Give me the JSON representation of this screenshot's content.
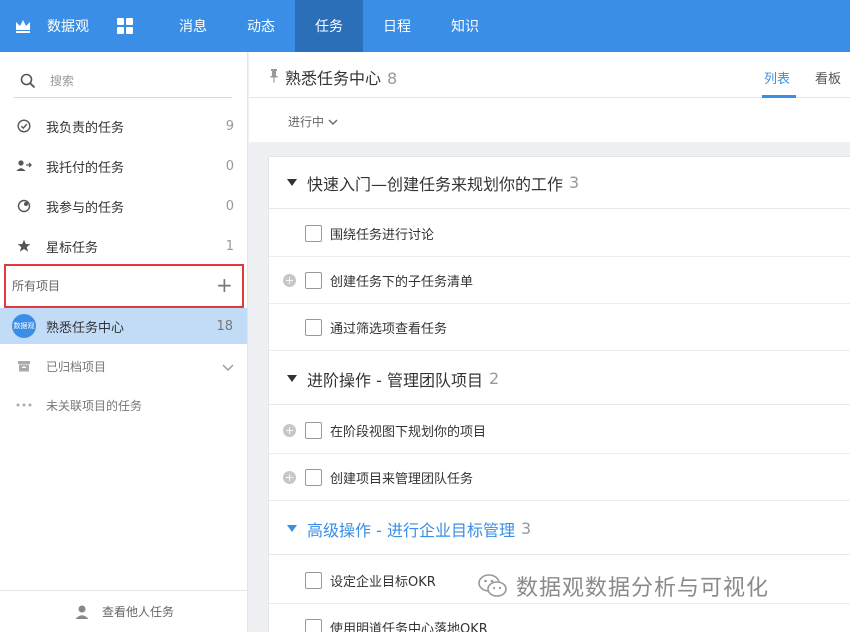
{
  "topnav": {
    "brand": "数据观",
    "items": [
      "消息",
      "动态",
      "任务",
      "日程",
      "知识"
    ],
    "active_index": 2,
    "bg": "#3a8ee6",
    "active_bg": "#2a6fb8"
  },
  "sidebar": {
    "search_placeholder": "搜索",
    "items": [
      {
        "icon": "check-circle-icon",
        "label": "我负责的任务",
        "count": "9"
      },
      {
        "icon": "user-forward-icon",
        "label": "我托付的任务",
        "count": "0"
      },
      {
        "icon": "participate-icon",
        "label": "我参与的任务",
        "count": "0"
      },
      {
        "icon": "star-icon",
        "label": "星标任务",
        "count": "1"
      }
    ],
    "projects_title": "所有项目",
    "project": {
      "avatar": "数据观",
      "name": "熟悉任务中心",
      "count": "18"
    },
    "archived": "已归档项目",
    "unlinked": "未关联项目的任务",
    "footer": "查看他人任务",
    "highlight_color": "#e0393e"
  },
  "main": {
    "title": "熟悉任务中心",
    "count": "8",
    "tabs": [
      "列表",
      "看板"
    ],
    "active_tab": 0,
    "filter": "进行中",
    "groups": [
      {
        "title": "快速入门—创建任务来规划你的工作",
        "count": "3",
        "tasks": [
          {
            "label": "围绕任务进行讨论",
            "subtask": false
          },
          {
            "label": "创建任务下的子任务清单",
            "subtask": true
          },
          {
            "label": "通过筛选项查看任务",
            "subtask": false
          }
        ]
      },
      {
        "title": "进阶操作 - 管理团队项目",
        "count": "2",
        "tasks": [
          {
            "label": "在阶段视图下规划你的项目",
            "subtask": true
          },
          {
            "label": "创建项目来管理团队任务",
            "subtask": true
          }
        ]
      },
      {
        "title": "高级操作 - 进行企业目标管理",
        "count": "3",
        "tasks": [
          {
            "label": "设定企业目标OKR",
            "subtask": false
          },
          {
            "label": "使用明道任务中心落地OKR",
            "subtask": false
          }
        ]
      }
    ]
  },
  "watermark": "数据观数据分析与可视化"
}
